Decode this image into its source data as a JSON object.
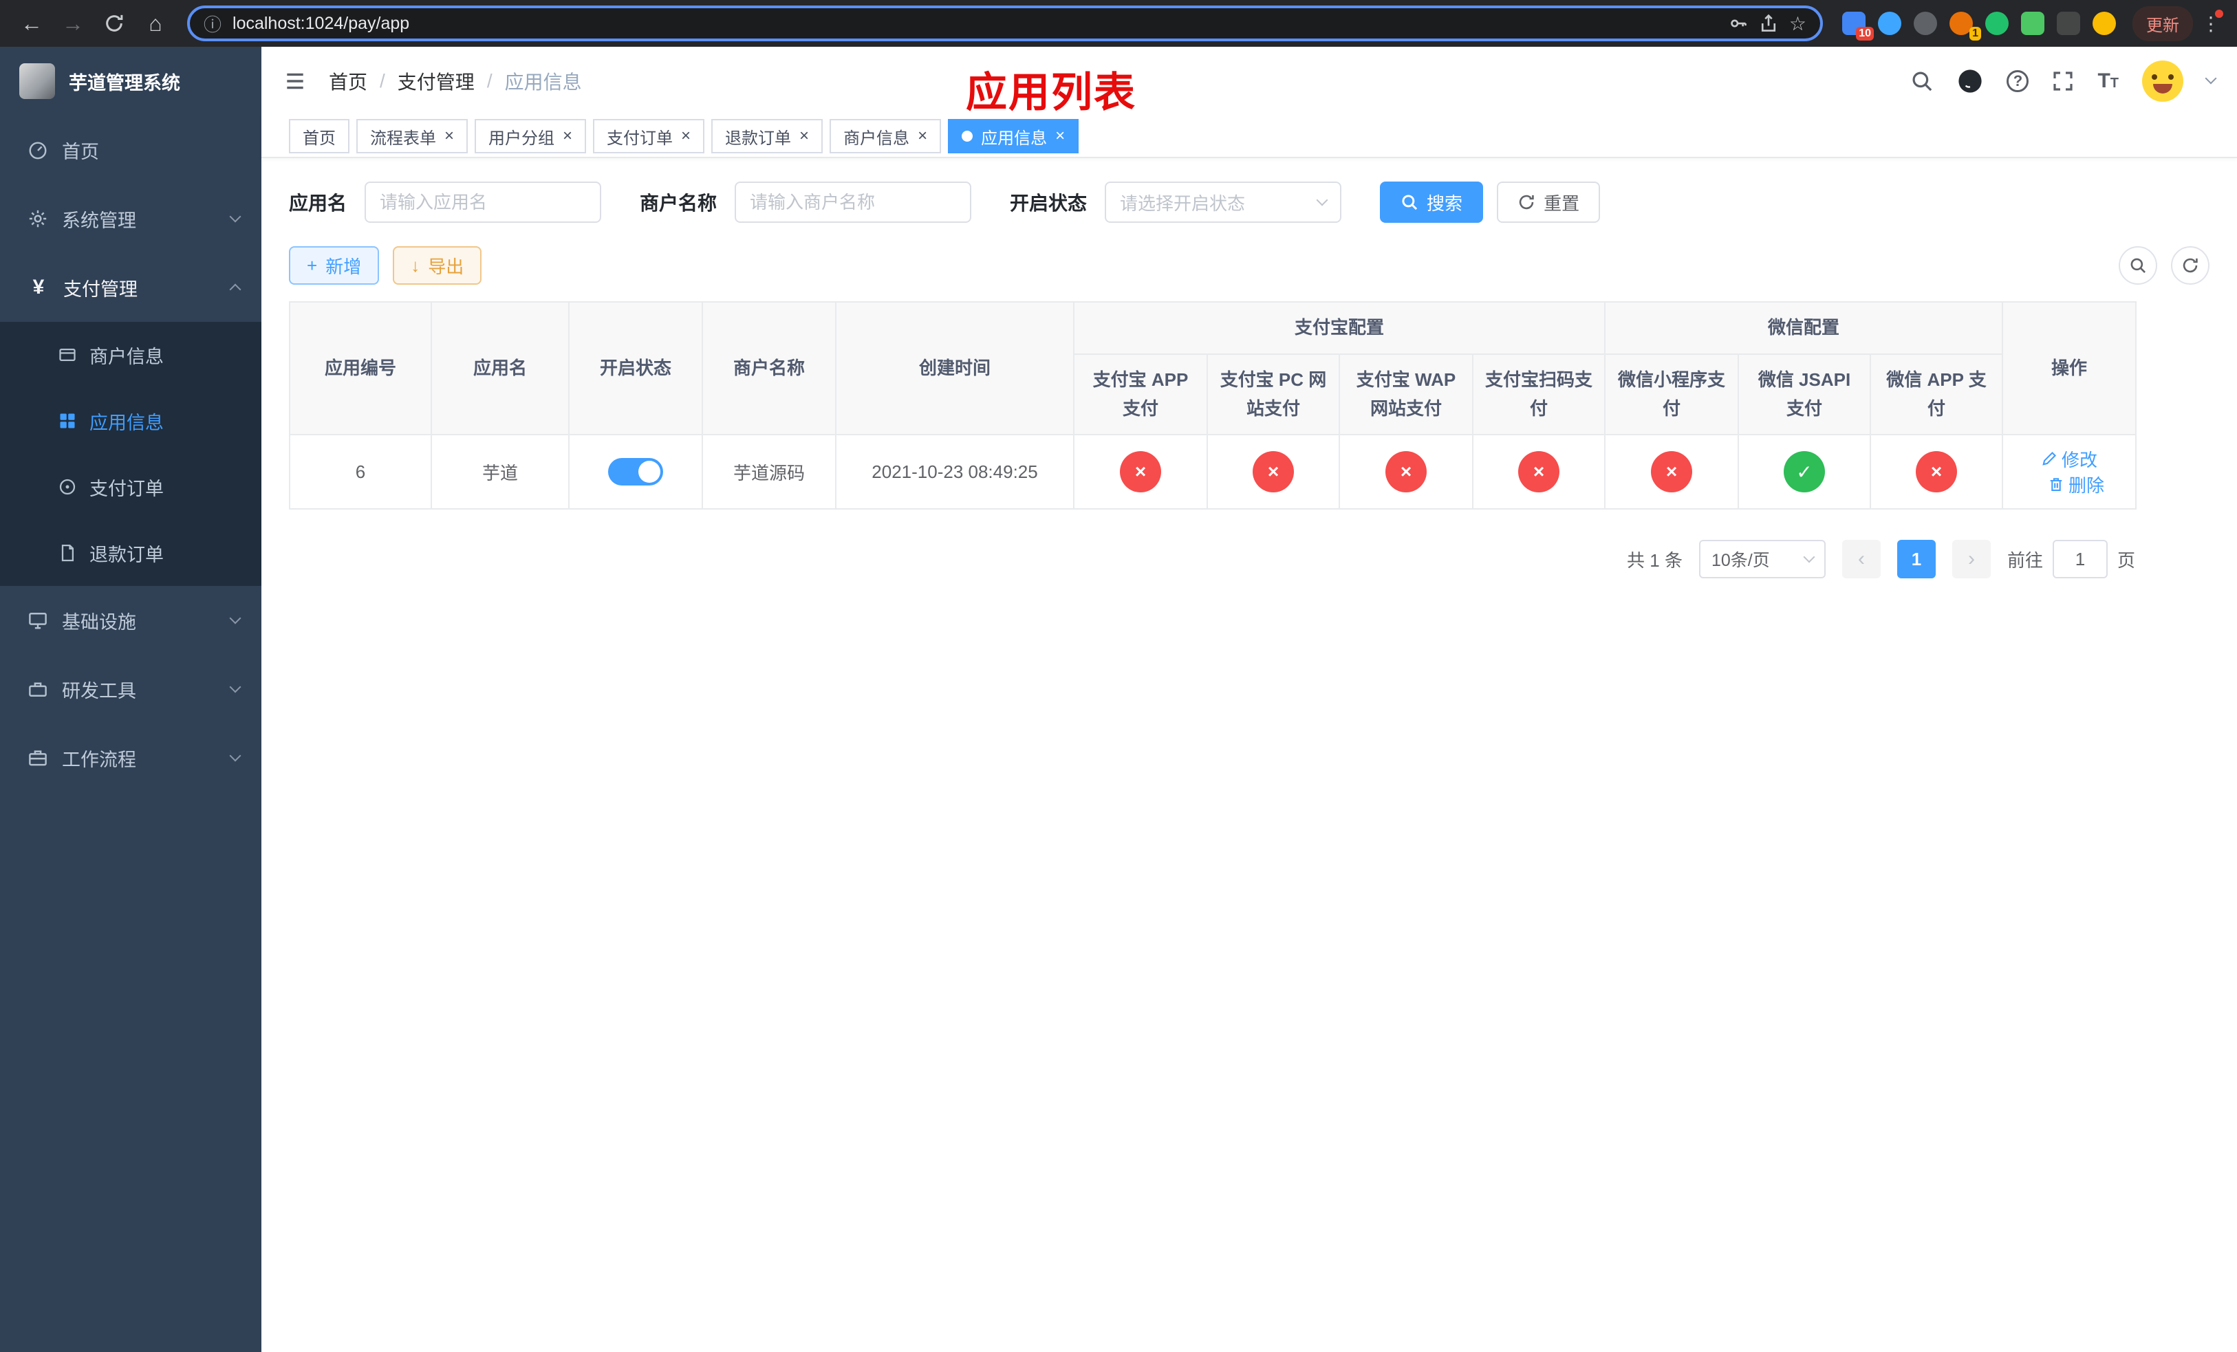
{
  "colors": {
    "accent": "#409eff",
    "danger": "#f64c4c",
    "success": "#2ebd57",
    "annotation_red": "#e60c0c",
    "sidebar_bg": "#304156",
    "submenu_bg": "#1f2d3d"
  },
  "icons": {
    "back": "←",
    "forward": "→",
    "home": "⌂",
    "info": "ⓘ",
    "star": "☆",
    "menu_dots": "⋮",
    "close": "×",
    "check": "✓",
    "cross": "×",
    "breadcrumb_sep": "/",
    "plus": "+",
    "download": "↓",
    "prev": "‹",
    "next": "›",
    "question": "?",
    "font_size_big": "T",
    "font_size_small": "T"
  },
  "browser": {
    "url": "localhost:1024/pay/app",
    "update_label": "更新",
    "ext_badge_count": "10",
    "avatar_ext_badge": "1"
  },
  "sidebar": {
    "title": "芋道管理系统",
    "home": "首页",
    "system": "系统管理",
    "payment": "支付管理",
    "merchant_info": "商户信息",
    "app_info": "应用信息",
    "pay_order": "支付订单",
    "refund_order": "退款订单",
    "infra": "基础设施",
    "devtools": "研发工具",
    "workflow": "工作流程"
  },
  "header": {
    "breadcrumb": {
      "home": "首页",
      "section": "支付管理",
      "current": "应用信息"
    },
    "annotation": "应用列表"
  },
  "tabs": {
    "items": [
      {
        "label": "首页",
        "closable": false
      },
      {
        "label": "流程表单",
        "closable": true
      },
      {
        "label": "用户分组",
        "closable": true
      },
      {
        "label": "支付订单",
        "closable": true
      },
      {
        "label": "退款订单",
        "closable": true
      },
      {
        "label": "商户信息",
        "closable": true
      },
      {
        "label": "应用信息",
        "closable": true,
        "active": true
      }
    ]
  },
  "filters": {
    "app_name_label": "应用名",
    "app_name_placeholder": "请输入应用名",
    "merchant_label": "商户名称",
    "merchant_placeholder": "请输入商户名称",
    "status_label": "开启状态",
    "status_placeholder": "请选择开启状态",
    "search_label": "搜索",
    "reset_label": "重置"
  },
  "toolbar": {
    "add_label": "新增",
    "export_label": "导出"
  },
  "table": {
    "headers": {
      "id": "应用编号",
      "name": "应用名",
      "status": "开启状态",
      "merchant": "商户名称",
      "created": "创建时间",
      "alipay_group": "支付宝配置",
      "wechat_group": "微信配置",
      "alipay_app": "支付宝 APP 支付",
      "alipay_pc": "支付宝 PC 网站支付",
      "alipay_wap": "支付宝 WAP 网站支付",
      "alipay_qr": "支付宝扫码支付",
      "wx_mini": "微信小程序支付",
      "wx_jsapi": "微信 JSAPI 支付",
      "wx_app": "微信 APP 支付",
      "actions": "操作"
    },
    "rows": [
      {
        "id": "6",
        "name": "芋道",
        "status_on": true,
        "merchant": "芋道源码",
        "created": "2021-10-23 08:49:25",
        "configs": {
          "alipay_app": false,
          "alipay_pc": false,
          "alipay_wap": false,
          "alipay_qr": false,
          "wx_mini": false,
          "wx_jsapi": true,
          "wx_app": false
        },
        "edit": "修改",
        "delete": "删除"
      }
    ]
  },
  "pagination": {
    "total": "共 1 条",
    "page_size": "10条/页",
    "current_page": "1",
    "goto_prefix": "前往",
    "goto_value": "1",
    "goto_suffix": "页"
  }
}
